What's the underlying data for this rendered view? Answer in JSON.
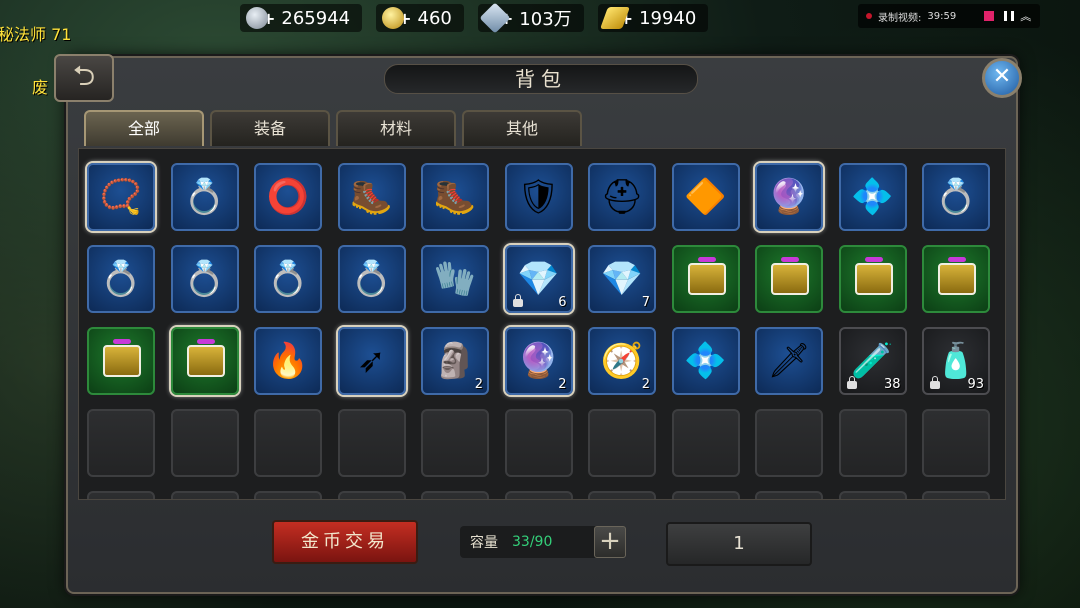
{
  "hud": {
    "left_texts": [
      {
        "text": "秘法师 71"
      },
      {
        "text": "废"
      }
    ],
    "resources": [
      {
        "icon": "silver-coin-icon",
        "value": "265944"
      },
      {
        "icon": "gold-coin-icon",
        "value": "460"
      },
      {
        "icon": "crystal-icon",
        "value": "103万"
      },
      {
        "icon": "gold-ingot-icon",
        "value": "19940"
      }
    ],
    "recording": {
      "label": "录制视频:",
      "time": "39:59"
    }
  },
  "panel": {
    "title": "背包",
    "tabs": [
      {
        "label": "全部",
        "active": true
      },
      {
        "label": "装备",
        "active": false
      },
      {
        "label": "材料",
        "active": false
      },
      {
        "label": "其他",
        "active": false
      }
    ],
    "items": [
      {
        "icon": "necklace-icon",
        "glyph": "📿",
        "bg": "blue",
        "selected": true,
        "count": "",
        "locked": false
      },
      {
        "icon": "ring-icon",
        "glyph": "💍",
        "bg": "blue",
        "selected": false,
        "count": "",
        "locked": false
      },
      {
        "icon": "bracelet-icon",
        "glyph": "⭕",
        "bg": "blue",
        "selected": false,
        "count": "",
        "locked": false
      },
      {
        "icon": "boots-icon",
        "glyph": "🥾",
        "bg": "blue",
        "selected": false,
        "count": "",
        "locked": false
      },
      {
        "icon": "boots-icon",
        "glyph": "🥾",
        "bg": "blue",
        "selected": false,
        "count": "",
        "locked": false
      },
      {
        "icon": "armor-icon",
        "glyph": "🛡",
        "bg": "blue",
        "selected": false,
        "count": "",
        "locked": false
      },
      {
        "icon": "helmet-icon",
        "glyph": "⛑",
        "bg": "blue",
        "selected": false,
        "count": "",
        "locked": false
      },
      {
        "icon": "belt-icon",
        "glyph": "🔶",
        "bg": "blue",
        "selected": false,
        "count": "",
        "locked": false
      },
      {
        "icon": "helmet-icon",
        "glyph": "🔮",
        "bg": "blue",
        "selected": true,
        "count": "",
        "locked": false
      },
      {
        "icon": "helmet-icon",
        "glyph": "💠",
        "bg": "blue",
        "selected": false,
        "count": "",
        "locked": false
      },
      {
        "icon": "ring-icon",
        "glyph": "💍",
        "bg": "blue",
        "selected": false,
        "count": "",
        "locked": false
      },
      {
        "icon": "ring-icon",
        "glyph": "💍",
        "bg": "blue",
        "selected": false,
        "count": "",
        "locked": false
      },
      {
        "icon": "ring-icon",
        "glyph": "💍",
        "bg": "blue",
        "selected": false,
        "count": "",
        "locked": false
      },
      {
        "icon": "ring-icon",
        "glyph": "💍",
        "bg": "blue",
        "selected": false,
        "count": "",
        "locked": false
      },
      {
        "icon": "ring-icon",
        "glyph": "💍",
        "bg": "blue",
        "selected": false,
        "count": "",
        "locked": false
      },
      {
        "icon": "gauntlet-icon",
        "glyph": "🧤",
        "bg": "blue",
        "selected": false,
        "count": "",
        "locked": false
      },
      {
        "icon": "blue-crystal-icon",
        "glyph": "💎",
        "bg": "blue",
        "selected": true,
        "count": "6",
        "locked": true
      },
      {
        "icon": "red-crystal-icon",
        "glyph": "💎",
        "bg": "blue",
        "selected": false,
        "count": "7",
        "locked": false
      },
      {
        "icon": "chest-icon",
        "glyph": "",
        "bg": "green",
        "selected": false,
        "count": "",
        "locked": false
      },
      {
        "icon": "chest-icon",
        "glyph": "",
        "bg": "green",
        "selected": false,
        "count": "",
        "locked": false
      },
      {
        "icon": "chest-icon",
        "glyph": "",
        "bg": "green",
        "selected": false,
        "count": "",
        "locked": false
      },
      {
        "icon": "chest-icon",
        "glyph": "",
        "bg": "green",
        "selected": false,
        "count": "",
        "locked": false
      },
      {
        "icon": "chest-icon",
        "glyph": "",
        "bg": "green",
        "selected": false,
        "count": "",
        "locked": false
      },
      {
        "icon": "chest-icon",
        "glyph": "",
        "bg": "green",
        "selected": true,
        "count": "",
        "locked": false
      },
      {
        "icon": "fire-brazier-icon",
        "glyph": "🔥",
        "bg": "blue",
        "selected": false,
        "count": "",
        "locked": false
      },
      {
        "icon": "arrow-icon",
        "glyph": "➶",
        "bg": "blue",
        "selected": true,
        "count": "",
        "locked": false
      },
      {
        "icon": "mask-icon",
        "glyph": "🗿",
        "bg": "blue",
        "selected": false,
        "count": "2",
        "locked": false
      },
      {
        "icon": "rainbow-stone-icon",
        "glyph": "🔮",
        "bg": "blue",
        "selected": true,
        "count": "2",
        "locked": false
      },
      {
        "icon": "compass-icon",
        "glyph": "🧭",
        "bg": "blue",
        "selected": false,
        "count": "2",
        "locked": false
      },
      {
        "icon": "crystal-cluster-icon",
        "glyph": "💠",
        "bg": "blue",
        "selected": false,
        "count": "",
        "locked": false
      },
      {
        "icon": "sword-icon",
        "glyph": "🗡",
        "bg": "blue",
        "selected": false,
        "count": "",
        "locked": false
      },
      {
        "icon": "red-potion-icon",
        "glyph": "🧪",
        "bg": "dark",
        "selected": false,
        "count": "38",
        "locked": true
      },
      {
        "icon": "blue-potion-icon",
        "glyph": "🧴",
        "bg": "dark",
        "selected": false,
        "count": "93",
        "locked": true
      }
    ],
    "gold_trade_label": "金币交易",
    "capacity_label": "容量",
    "capacity_value": "33/90",
    "page_number": "1"
  }
}
